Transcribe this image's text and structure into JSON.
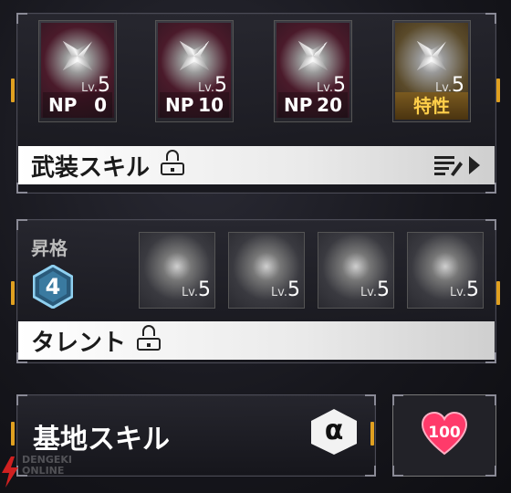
{
  "weapon_panel": {
    "cards": [
      {
        "kind": "np",
        "np_text": "NP",
        "np_value": "0",
        "lv_prefix": "Lv.",
        "lv_value": "5"
      },
      {
        "kind": "np",
        "np_text": "NP",
        "np_value": "10",
        "lv_prefix": "Lv.",
        "lv_value": "5"
      },
      {
        "kind": "np",
        "np_text": "NP",
        "np_value": "20",
        "lv_prefix": "Lv.",
        "lv_value": "5"
      },
      {
        "kind": "trait",
        "trait_label": "特性",
        "lv_prefix": "Lv.",
        "lv_value": "5"
      }
    ],
    "skill_bar_label": "武装スキル"
  },
  "talent_panel": {
    "rank_label": "昇格",
    "rank_value": "4",
    "cards": [
      {
        "lv_prefix": "Lv.",
        "lv_value": "5"
      },
      {
        "lv_prefix": "Lv.",
        "lv_value": "5"
      },
      {
        "lv_prefix": "Lv.",
        "lv_value": "5"
      },
      {
        "lv_prefix": "Lv.",
        "lv_value": "5"
      }
    ],
    "talent_bar_label": "タレント"
  },
  "base_panel": {
    "label": "基地スキル",
    "alpha_symbol": "α",
    "heart_value": "100"
  },
  "watermark": {
    "line1": "DENGEKI",
    "line2": "ONLINE"
  },
  "colors": {
    "accent_gold": "#e0a020",
    "trait_text": "#ffcf4a",
    "heart": "#ff3a6a"
  }
}
